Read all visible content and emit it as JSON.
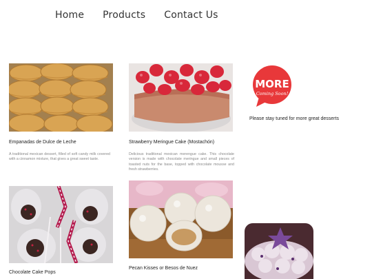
{
  "nav": {
    "items": [
      {
        "label": "Home"
      },
      {
        "label": "Products"
      },
      {
        "label": "Contact Us"
      }
    ]
  },
  "products": [
    {
      "title": "Empanadas de Dulce de Leche",
      "description": "A traditional mexican dessert, filled of soft candy milk covered with a cinnamon mixture, that gives a great sweet taste."
    },
    {
      "title": "Strawberry Meringue Cake (Mostachón)",
      "description": "Delicious traditional mexican merengue cake. This chocolate version is made with chocolate meringue and small pieces of toasted nuts for the base, topped with chocolate mousse and fresh strawberries."
    },
    {
      "title": "Chocolate Cake Pops",
      "description": ""
    },
    {
      "title": "Pecan Kisses or Besos de Nuez",
      "description": ""
    }
  ],
  "promo": {
    "badge_main": "MORE",
    "badge_sub": "Coming Soon!",
    "badge_color": "#e8383a",
    "message": "Please stay tuned for more great desserts"
  }
}
